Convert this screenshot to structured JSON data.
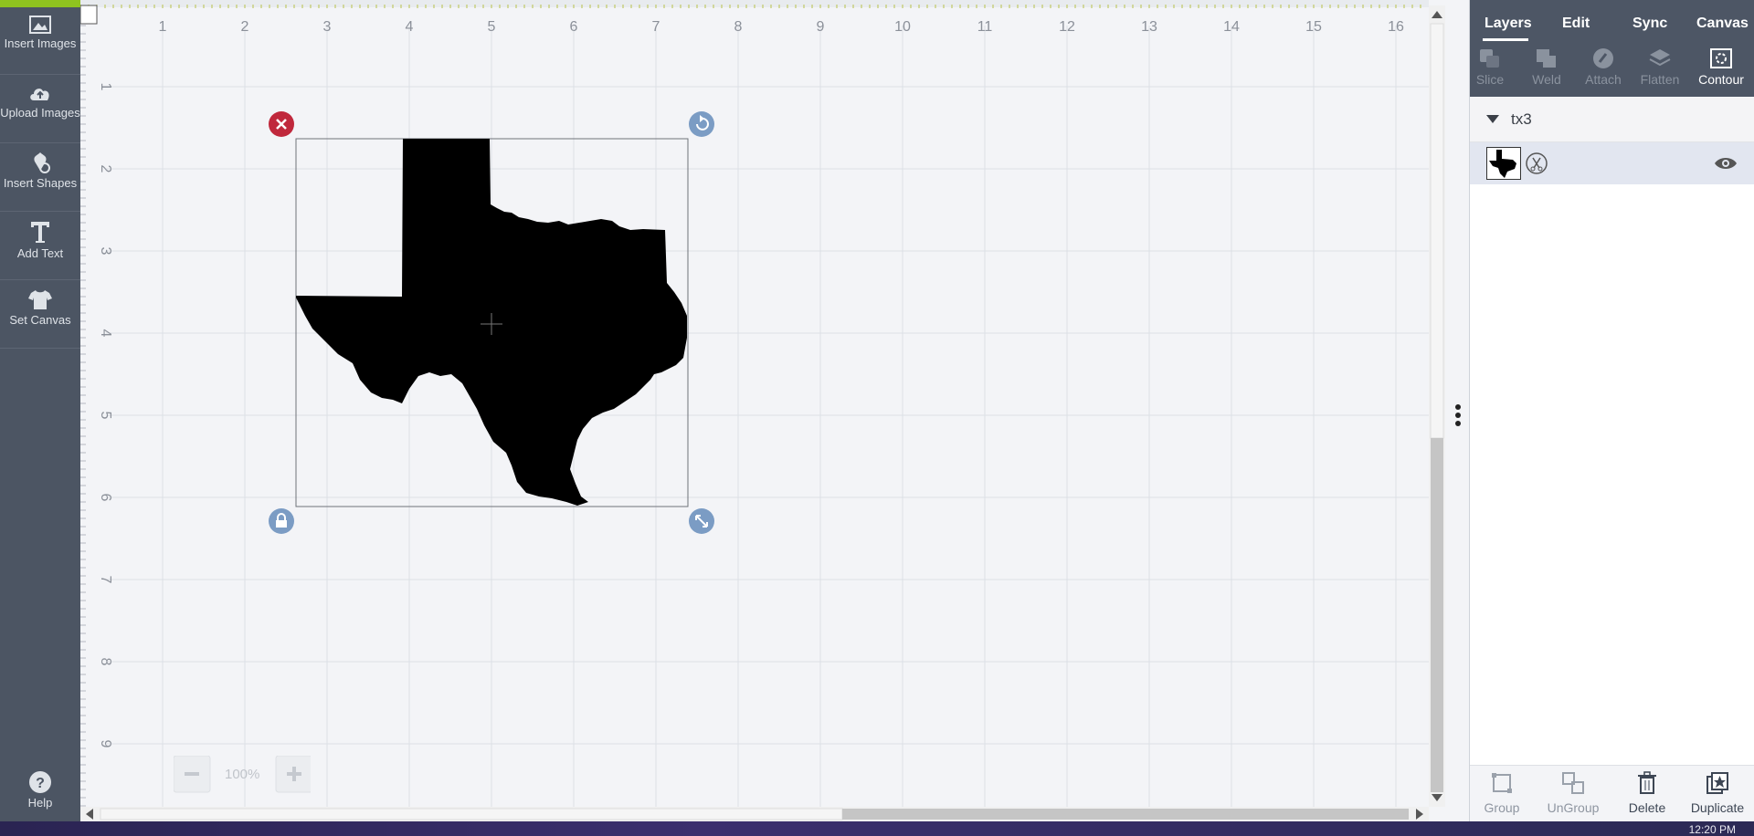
{
  "sidebar": {
    "items": [
      {
        "label": "Insert Images",
        "icon": "image-icon"
      },
      {
        "label": "Upload Images",
        "icon": "cloud-upload-icon"
      },
      {
        "label": "Insert Shapes",
        "icon": "shapes-icon"
      },
      {
        "label": "Add Text",
        "icon": "text-icon"
      },
      {
        "label": "Set Canvas",
        "icon": "tshirt-icon"
      }
    ],
    "help_label": "Help"
  },
  "ruler": {
    "top_ticks": [
      "1",
      "2",
      "3",
      "4",
      "5",
      "6",
      "7",
      "8",
      "9",
      "10",
      "11",
      "12",
      "13",
      "14",
      "15",
      "16"
    ],
    "left_ticks": [
      "1",
      "2",
      "3",
      "4",
      "5",
      "6",
      "7",
      "8",
      "9"
    ]
  },
  "zoom": {
    "value": "100%"
  },
  "panel": {
    "tabs": [
      "Layers",
      "Edit",
      "Sync",
      "Canvas"
    ],
    "active_tab": "Layers",
    "tools": [
      {
        "label": "Slice",
        "enabled": false
      },
      {
        "label": "Weld",
        "enabled": false
      },
      {
        "label": "Attach",
        "enabled": false
      },
      {
        "label": "Flatten",
        "enabled": false
      },
      {
        "label": "Contour",
        "enabled": true
      }
    ],
    "group_name": "tx3",
    "bottom_tools": [
      {
        "label": "Group",
        "enabled": false
      },
      {
        "label": "UnGroup",
        "enabled": false
      },
      {
        "label": "Delete",
        "enabled": true
      },
      {
        "label": "Duplicate",
        "enabled": true
      }
    ]
  },
  "taskbar": {
    "time": "12:20 PM"
  },
  "colors": {
    "sidebar": "#4c5563",
    "accent": "#8fc31f",
    "delete_handle": "#c0283c",
    "handle": "#7b9cc4"
  }
}
